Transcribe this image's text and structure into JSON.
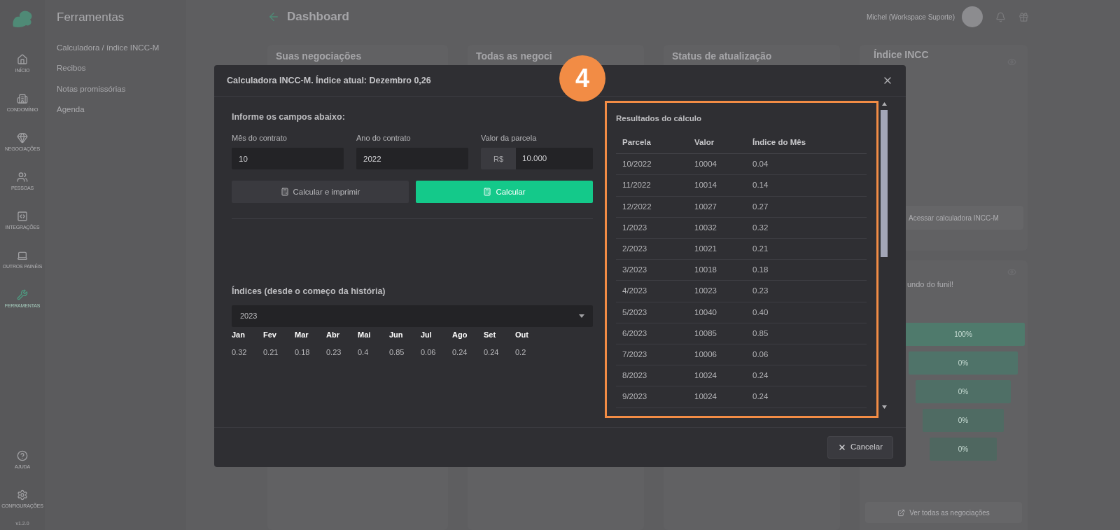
{
  "sidebar": {
    "items": [
      {
        "label": "INÍCIO",
        "selected": false
      },
      {
        "label": "CONDOMÍNIO",
        "selected": false
      },
      {
        "label": "NEGOCIAÇÕES",
        "selected": false
      },
      {
        "label": "PESSOAS",
        "selected": false
      },
      {
        "label": "INTEGRAÇÕES",
        "selected": false
      },
      {
        "label": "OUTROS PAINÉIS",
        "selected": false
      },
      {
        "label": "FERRAMENTAS",
        "selected": true
      }
    ],
    "bottom_items": [
      {
        "label": "AJUDA"
      },
      {
        "label": "CONFIGURAÇÕES"
      }
    ],
    "version": "v1.2.0"
  },
  "tools_panel": {
    "title": "Ferramentas",
    "items": [
      "Calculadora / índice INCC-M",
      "Recibos",
      "Notas promissórias",
      "Agenda"
    ]
  },
  "header": {
    "title": "Dashboard",
    "user": "Michel (Workspace Suporte)"
  },
  "cards": [
    "Suas negociações",
    "Todas as negoci",
    "Status de atualização"
  ],
  "incc_card": {
    "title": "Índice INCC",
    "button": "Acessar calculadora INCC-M"
  },
  "funnel_card": {
    "text": "undo do funil!",
    "bars": [
      "100%",
      "0%",
      "0%",
      "0%",
      "0%"
    ],
    "footer_button": "Ver todas as negociações"
  },
  "modal": {
    "title": "Calculadora INCC-M. Índice atual: Dezembro 0,26",
    "form_title": "Informe os campos abaixo:",
    "fields": [
      {
        "label": "Mês do contrato",
        "value": "10"
      },
      {
        "label": "Ano do contrato",
        "value": "2022"
      },
      {
        "label": "Valor da parcela",
        "prefix": "R$",
        "value": "10.000"
      }
    ],
    "buttons": [
      {
        "label": "Calcular e imprimir",
        "kind": "secondary"
      },
      {
        "label": "Calcular",
        "kind": "primary"
      }
    ],
    "indices_title": "Índices (desde o começo da história)",
    "year_select": "2023",
    "months": [
      {
        "month": "Jan",
        "value": "0.32"
      },
      {
        "month": "Fev",
        "value": "0.21"
      },
      {
        "month": "Mar",
        "value": "0.18"
      },
      {
        "month": "Abr",
        "value": "0.23"
      },
      {
        "month": "Mai",
        "value": "0.4"
      },
      {
        "month": "Jun",
        "value": "0.85"
      },
      {
        "month": "Jul",
        "value": "0.06"
      },
      {
        "month": "Ago",
        "value": "0.24"
      },
      {
        "month": "Set",
        "value": "0.24"
      },
      {
        "month": "Out",
        "value": "0.2"
      }
    ],
    "results": {
      "title": "Resultados do cálculo",
      "columns": [
        "Parcela",
        "Valor",
        "Índice do Mês"
      ],
      "rows": [
        [
          "10/2022",
          "10004",
          "0.04"
        ],
        [
          "11/2022",
          "10014",
          "0.14"
        ],
        [
          "12/2022",
          "10027",
          "0.27"
        ],
        [
          "1/2023",
          "10032",
          "0.32"
        ],
        [
          "2/2023",
          "10021",
          "0.21"
        ],
        [
          "3/2023",
          "10018",
          "0.18"
        ],
        [
          "4/2023",
          "10023",
          "0.23"
        ],
        [
          "5/2023",
          "10040",
          "0.40"
        ],
        [
          "6/2023",
          "10085",
          "0.85"
        ],
        [
          "7/2023",
          "10006",
          "0.06"
        ],
        [
          "8/2023",
          "10024",
          "0.24"
        ],
        [
          "9/2023",
          "10024",
          "0.24"
        ]
      ]
    },
    "cancel": "Cancelar"
  },
  "tutorial": {
    "step": "4"
  }
}
